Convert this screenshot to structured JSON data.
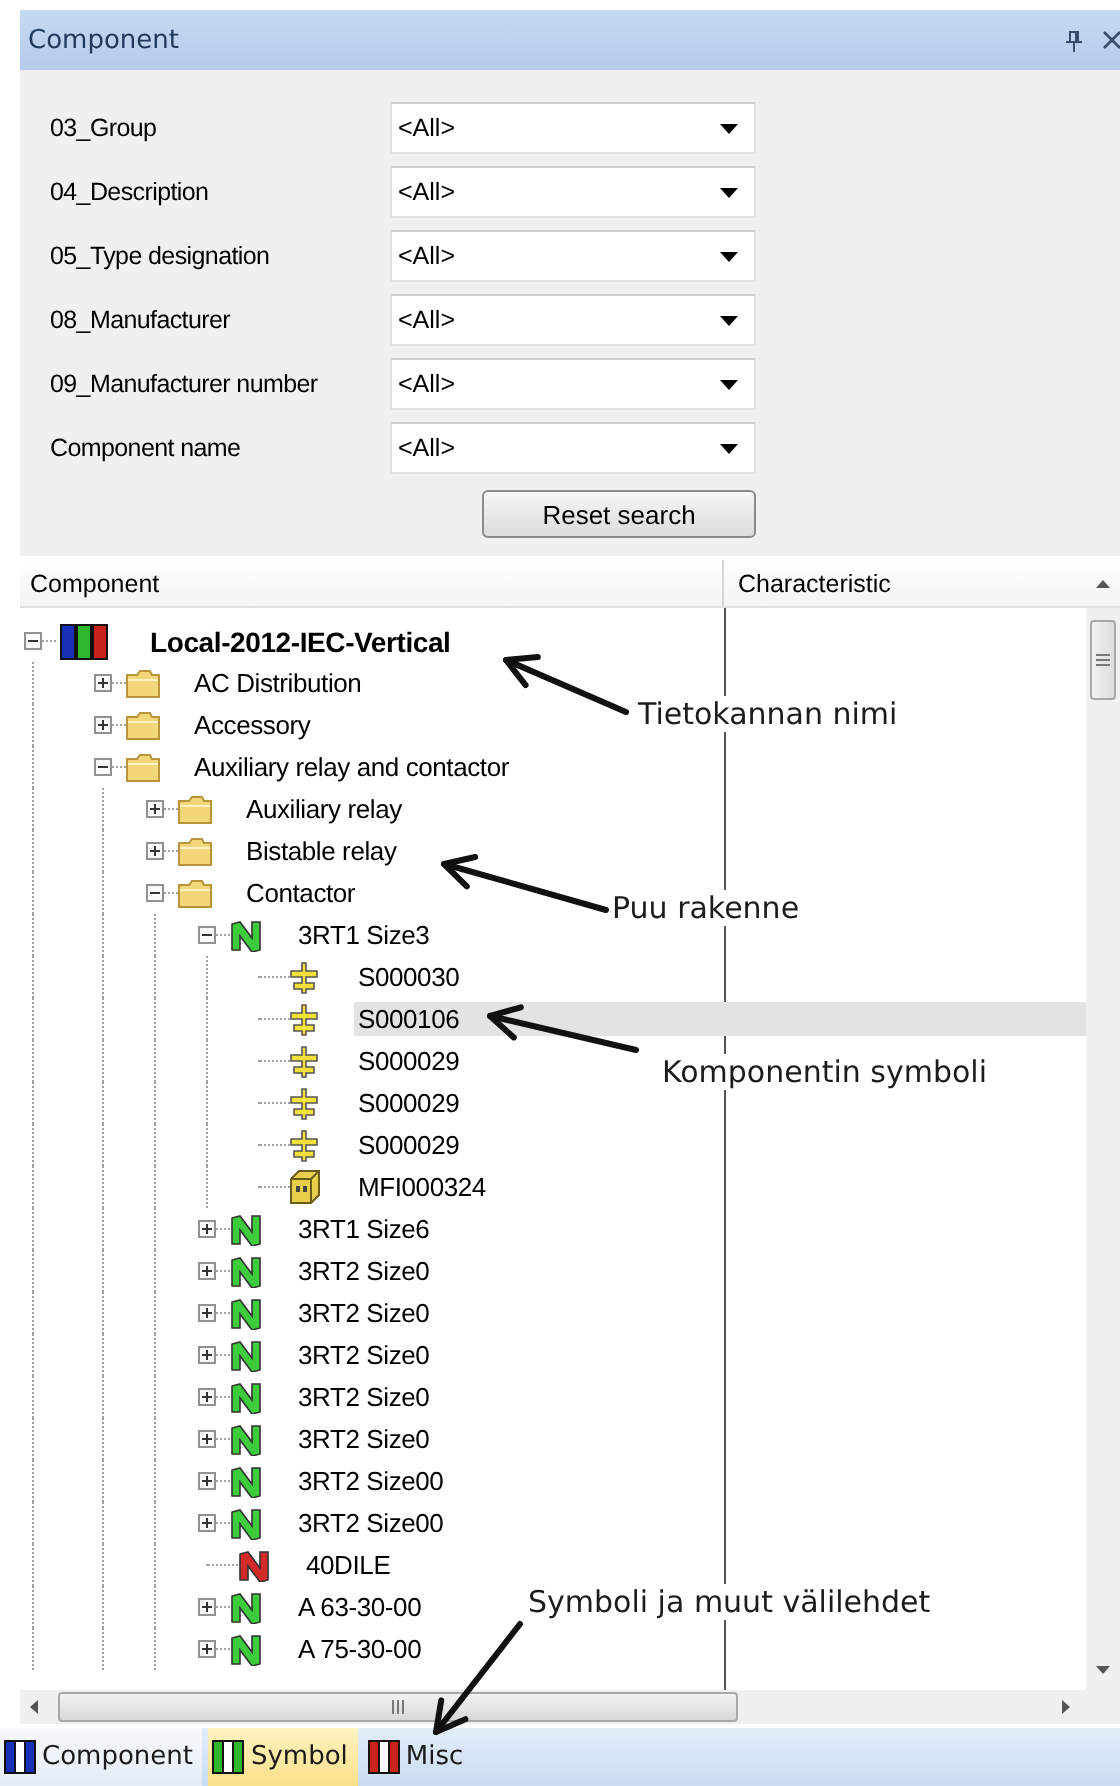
{
  "panel": {
    "title": "Component"
  },
  "filters": [
    {
      "label": "03_Group",
      "value": "<All>"
    },
    {
      "label": "04_Description",
      "value": "<All>"
    },
    {
      "label": "05_Type designation",
      "value": "<All>"
    },
    {
      "label": "08_Manufacturer",
      "value": "<All>"
    },
    {
      "label": "09_Manufacturer number",
      "value": "<All>"
    },
    {
      "label": "Component name",
      "value": "<All>"
    }
  ],
  "reset_button": "Reset search",
  "tree": {
    "columns": [
      "Component",
      "Characteristic"
    ],
    "items": [
      {
        "label": "Local-2012-IEC-Vertical",
        "kind": "database",
        "expanded": true,
        "selected": false,
        "children": [
          {
            "label": "AC Distribution",
            "kind": "folder",
            "expanded": false,
            "selected": false
          },
          {
            "label": "Accessory",
            "kind": "folder",
            "expanded": false,
            "selected": false
          },
          {
            "label": "Auxiliary relay and contactor",
            "kind": "folder",
            "expanded": true,
            "selected": false,
            "children": [
              {
                "label": "Auxiliary relay",
                "kind": "folder",
                "expanded": false,
                "selected": false
              },
              {
                "label": "Bistable relay",
                "kind": "folder",
                "expanded": false,
                "selected": false
              },
              {
                "label": "Contactor",
                "kind": "folder",
                "expanded": true,
                "selected": false,
                "children": [
                  {
                    "label": "3RT1 Size3",
                    "kind": "component",
                    "color": "#3ccc3c",
                    "expanded": true,
                    "selected": false,
                    "children": [
                      {
                        "label": "S000030",
                        "kind": "symbol",
                        "selected": false
                      },
                      {
                        "label": "S000106",
                        "kind": "symbol",
                        "selected": true
                      },
                      {
                        "label": "S000029",
                        "kind": "symbol",
                        "selected": false
                      },
                      {
                        "label": "S000029",
                        "kind": "symbol",
                        "selected": false
                      },
                      {
                        "label": "S000029",
                        "kind": "symbol",
                        "selected": false
                      },
                      {
                        "label": "MFI000324",
                        "kind": "part",
                        "selected": false
                      }
                    ]
                  },
                  {
                    "label": "3RT1 Size6",
                    "kind": "component",
                    "color": "#3ccc3c",
                    "expanded": false,
                    "selected": false
                  },
                  {
                    "label": "3RT2 Size0",
                    "kind": "component",
                    "color": "#3ccc3c",
                    "expanded": false,
                    "selected": false
                  },
                  {
                    "label": "3RT2 Size0",
                    "kind": "component",
                    "color": "#3ccc3c",
                    "expanded": false,
                    "selected": false
                  },
                  {
                    "label": "3RT2 Size0",
                    "kind": "component",
                    "color": "#3ccc3c",
                    "expanded": false,
                    "selected": false
                  },
                  {
                    "label": "3RT2 Size0",
                    "kind": "component",
                    "color": "#3ccc3c",
                    "expanded": false,
                    "selected": false
                  },
                  {
                    "label": "3RT2 Size0",
                    "kind": "component",
                    "color": "#3ccc3c",
                    "expanded": false,
                    "selected": false
                  },
                  {
                    "label": "3RT2 Size00",
                    "kind": "component",
                    "color": "#3ccc3c",
                    "expanded": false,
                    "selected": false
                  },
                  {
                    "label": "3RT2 Size00",
                    "kind": "component",
                    "color": "#3ccc3c",
                    "expanded": false,
                    "selected": false
                  },
                  {
                    "label": "40DILE",
                    "kind": "component",
                    "color": "#d42a2a",
                    "selected": false
                  },
                  {
                    "label": "A 63-30-00",
                    "kind": "component",
                    "color": "#3ccc3c",
                    "expanded": false,
                    "selected": false
                  },
                  {
                    "label": "A 75-30-00",
                    "kind": "component",
                    "color": "#3ccc3c",
                    "expanded": false,
                    "selected": false
                  }
                ]
              }
            ]
          }
        ]
      }
    ]
  },
  "tabs": [
    {
      "label": "Component",
      "color": "#1a2fb8",
      "selected": true,
      "hovered": false
    },
    {
      "label": "Symbol",
      "color": "#2eb82e",
      "selected": false,
      "hovered": true
    },
    {
      "label": "Misc",
      "color": "#c8241c",
      "selected": false,
      "hovered": false
    }
  ],
  "annotations": [
    {
      "text": "Tietokannan nimi",
      "kind": "arrow"
    },
    {
      "text": "Puu rakenne",
      "kind": "arrow"
    },
    {
      "text": "Komponentin symboli",
      "kind": "arrow"
    },
    {
      "text": "Symboli ja muut välilehdet",
      "kind": "arrow"
    }
  ]
}
